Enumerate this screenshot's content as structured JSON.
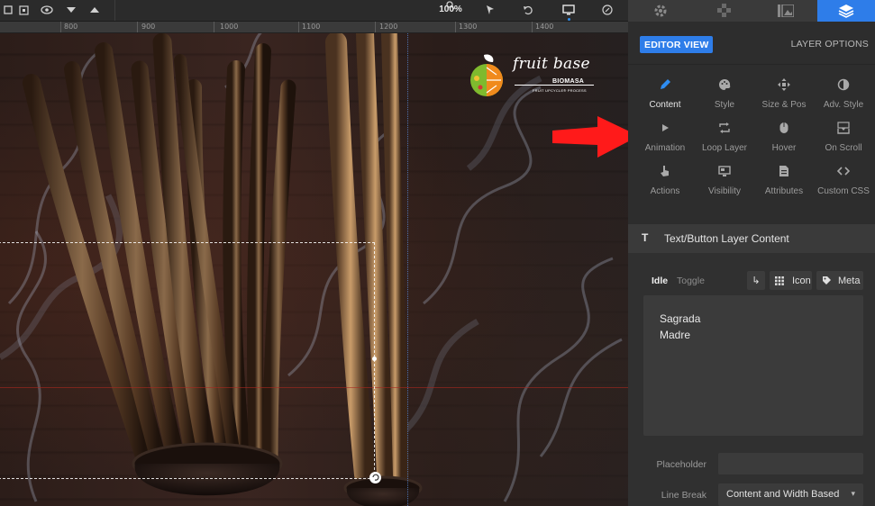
{
  "toolbar": {
    "zoom": "100%",
    "icons": [
      "layers-icon",
      "frame-icon",
      "visibility-icon",
      "chevron-down-icon",
      "chevron-up-icon",
      "zoom-icon",
      "cursor-pin-icon",
      "undo-icon",
      "desktop-icon",
      "help-icon"
    ]
  },
  "ruler": {
    "labels": [
      "800",
      "900",
      "1000",
      "1100",
      "1200",
      "1300",
      "1400"
    ]
  },
  "canvas": {
    "logo": {
      "wordmark": "fruit base",
      "subtitle": "BIOMASA",
      "tagline": "FRUIT UPCYCLE® PROCESS"
    }
  },
  "panel": {
    "tabs": [
      "settings-icon",
      "modules-icon",
      "media-icon",
      "layers-icon"
    ],
    "active_tab": "layers-icon",
    "editor_view": "EDITOR VIEW",
    "layer_options": "LAYER OPTIONS",
    "tools": [
      {
        "label": "Content",
        "icon": "pencil-icon",
        "active": true
      },
      {
        "label": "Style",
        "icon": "palette-icon",
        "active": false
      },
      {
        "label": "Size & Pos",
        "icon": "move-arrows-icon",
        "active": false
      },
      {
        "label": "Adv. Style",
        "icon": "contrast-icon",
        "active": false
      },
      {
        "label": "Animation",
        "icon": "play-icon",
        "active": false
      },
      {
        "label": "Loop Layer",
        "icon": "loop-icon",
        "active": false
      },
      {
        "label": "Hover",
        "icon": "mouse-icon",
        "active": false
      },
      {
        "label": "On Scroll",
        "icon": "scroll-download-icon",
        "active": false
      },
      {
        "label": "Actions",
        "icon": "pointer-hand-icon",
        "active": false
      },
      {
        "label": "Visibility",
        "icon": "monitor-icon",
        "active": false
      },
      {
        "label": "Attributes",
        "icon": "document-icon",
        "active": false
      },
      {
        "label": "Custom CSS",
        "icon": "code-icon",
        "active": false
      }
    ],
    "section_title": "Text/Button Layer Content",
    "content_tabs": {
      "idle": "Idle",
      "toggle": "Toggle"
    },
    "buttons": {
      "icon": "Icon",
      "meta": "Meta"
    },
    "text_content": "Sagrada\nMadre",
    "placeholder_label": "Placeholder",
    "placeholder_value": "",
    "line_break_label": "Line Break",
    "line_break_value": "Content and Width Based"
  },
  "annotation": {
    "arrow_color": "#ff1a1a",
    "accent_color": "#2e7de9"
  }
}
